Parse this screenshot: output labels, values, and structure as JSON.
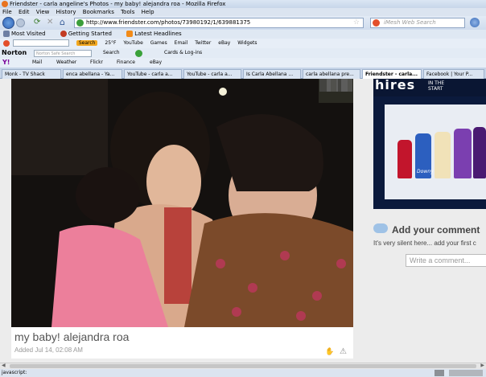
{
  "window": {
    "title": "Friendster - carla angeline's Photos - my baby! alejandra roa - Mozilla Firefox"
  },
  "menu": [
    "File",
    "Edit",
    "View",
    "History",
    "Bookmarks",
    "Tools",
    "Help"
  ],
  "nav": {
    "url": "http://www.friendster.com/photos/73980192/1/639881375",
    "search_placeholder": "iMesh Web Search"
  },
  "bookmarks": [
    "Most Visited",
    "Getting Started",
    "Latest Headlines"
  ],
  "toolbar1": {
    "search_btn": "Search",
    "weather": "25°F",
    "items": [
      "YouTube",
      "Games",
      "Email",
      "Twitter",
      "eBay",
      "Widgets"
    ]
  },
  "toolbar2": {
    "brand": "Norton",
    "search_placeholder": "Norton Safe Search",
    "search_btn": "Search",
    "cards": "Cards & Log-ins"
  },
  "toolbar3": {
    "items": [
      "Mail",
      "Weather",
      "Flickr",
      "Finance",
      "eBay"
    ]
  },
  "tabs": [
    "Monk - TV Shack",
    "enca abellana - Ya...",
    "YouTube - carla a...",
    "YouTube - carla a...",
    "Is Carla Abellana ...",
    "carla abellana pre...",
    "Friendster - carla...",
    "Facebook | Your P..."
  ],
  "photo": {
    "caption": "my baby! alejandra roa",
    "added": "Added Jul 14, 02:08 AM"
  },
  "ad": {
    "headline": "hires",
    "tagline": "in the start",
    "product": "Downy"
  },
  "comments": {
    "title": "Add your comment",
    "empty_text": "It's very silent here... add your first c",
    "placeholder": "Write a comment..."
  },
  "status": {
    "text": "javascript:"
  }
}
